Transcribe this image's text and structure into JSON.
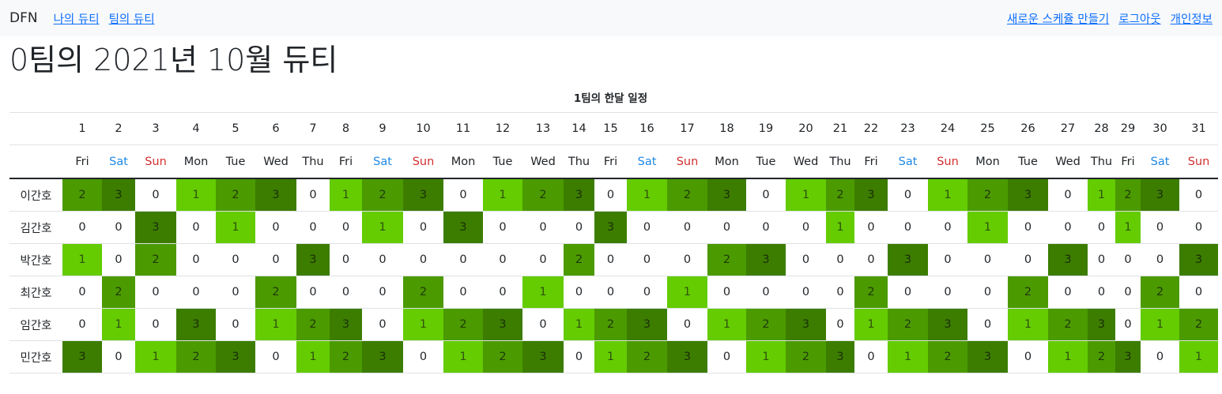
{
  "navbar": {
    "brand": "DFN",
    "left_links": [
      "나의 듀티",
      "팀의 듀티"
    ],
    "right_links": [
      "새로운 스케쥴 만들기",
      "로그아웃",
      "개인정보"
    ]
  },
  "page_title": "0팀의 2021년 10월 듀티",
  "table": {
    "caption": "1팀의 한달 일정",
    "days": [
      "1",
      "2",
      "3",
      "4",
      "5",
      "6",
      "7",
      "8",
      "9",
      "10",
      "11",
      "12",
      "13",
      "14",
      "15",
      "16",
      "17",
      "18",
      "19",
      "20",
      "21",
      "22",
      "23",
      "24",
      "25",
      "26",
      "27",
      "28",
      "29",
      "30",
      "31"
    ],
    "weekdays": [
      "Fri",
      "Sat",
      "Sun",
      "Mon",
      "Tue",
      "Wed",
      "Thu",
      "Fri",
      "Sat",
      "Sun",
      "Mon",
      "Tue",
      "Wed",
      "Thu",
      "Fri",
      "Sat",
      "Sun",
      "Mon",
      "Tue",
      "Wed",
      "Thu",
      "Fri",
      "Sat",
      "Sun",
      "Mon",
      "Tue",
      "Wed",
      "Thu",
      "Fri",
      "Sat",
      "Sun"
    ],
    "rows": [
      {
        "name": "이간호",
        "values": [
          "2",
          "3",
          "0",
          "1",
          "2",
          "3",
          "0",
          "1",
          "2",
          "3",
          "0",
          "1",
          "2",
          "3",
          "0",
          "1",
          "2",
          "3",
          "0",
          "1",
          "2",
          "3",
          "0",
          "1",
          "2",
          "3",
          "0",
          "1",
          "2",
          "3",
          "0"
        ]
      },
      {
        "name": "김간호",
        "values": [
          "0",
          "0",
          "3",
          "0",
          "1",
          "0",
          "0",
          "0",
          "1",
          "0",
          "3",
          "0",
          "0",
          "0",
          "3",
          "0",
          "0",
          "0",
          "0",
          "0",
          "1",
          "0",
          "0",
          "0",
          "1",
          "0",
          "0",
          "0",
          "1",
          "0",
          "0"
        ]
      },
      {
        "name": "박간호",
        "values": [
          "1",
          "0",
          "2",
          "0",
          "0",
          "0",
          "3",
          "0",
          "0",
          "0",
          "0",
          "0",
          "0",
          "2",
          "0",
          "0",
          "0",
          "2",
          "3",
          "0",
          "0",
          "0",
          "3",
          "0",
          "0",
          "0",
          "3",
          "0",
          "0",
          "0",
          "3"
        ]
      },
      {
        "name": "최간호",
        "values": [
          "0",
          "2",
          "0",
          "0",
          "0",
          "2",
          "0",
          "0",
          "0",
          "2",
          "0",
          "0",
          "1",
          "0",
          "0",
          "0",
          "1",
          "0",
          "0",
          "0",
          "0",
          "2",
          "0",
          "0",
          "0",
          "2",
          "0",
          "0",
          "0",
          "2",
          "0"
        ]
      },
      {
        "name": "임간호",
        "values": [
          "0",
          "1",
          "0",
          "3",
          "0",
          "1",
          "2",
          "3",
          "0",
          "1",
          "2",
          "3",
          "0",
          "1",
          "2",
          "3",
          "0",
          "1",
          "2",
          "3",
          "0",
          "1",
          "2",
          "3",
          "0",
          "1",
          "2",
          "3",
          "0",
          "1",
          "2"
        ]
      },
      {
        "name": "민간호",
        "values": [
          "3",
          "0",
          "1",
          "2",
          "3",
          "0",
          "1",
          "2",
          "3",
          "0",
          "1",
          "2",
          "3",
          "0",
          "1",
          "2",
          "3",
          "0",
          "1",
          "2",
          "3",
          "0",
          "1",
          "2",
          "3",
          "0",
          "1",
          "2",
          "3",
          "0",
          "1"
        ]
      }
    ]
  },
  "colors": {
    "duty_1": "#64cc00",
    "duty_2": "#4b9a00",
    "duty_3": "#3c7d00",
    "saturday": "#1e88e5",
    "sunday": "#d32f2f",
    "link": "#0d6efd"
  }
}
